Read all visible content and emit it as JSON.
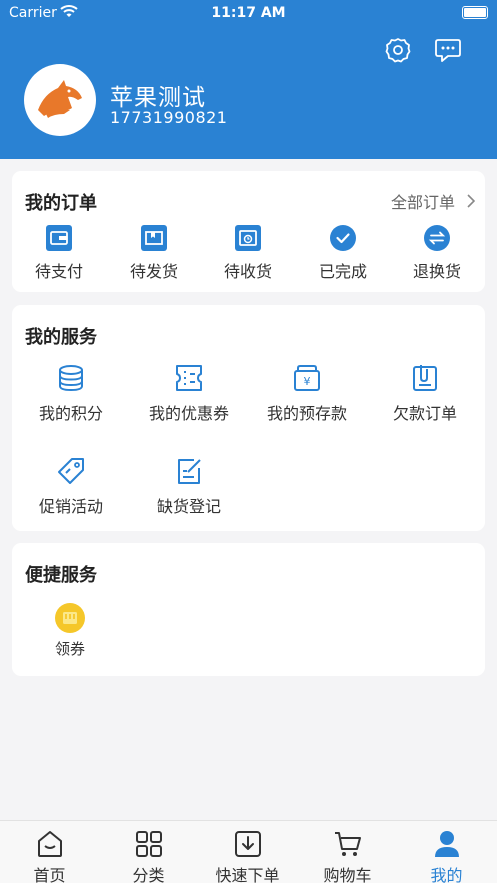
{
  "status_bar": {
    "carrier": "Carrier",
    "time": "11:17 AM"
  },
  "user": {
    "name": "苹果测试",
    "phone": "17731990821"
  },
  "orders": {
    "title": "我的订单",
    "all_label": "全部订单",
    "items": [
      {
        "label": "待支付",
        "icon": "wallet-icon"
      },
      {
        "label": "待发货",
        "icon": "box-icon"
      },
      {
        "label": "待收货",
        "icon": "clock-icon"
      },
      {
        "label": "已完成",
        "icon": "check-circle-icon"
      },
      {
        "label": "退换货",
        "icon": "exchange-icon"
      }
    ]
  },
  "services": {
    "title": "我的服务",
    "items": [
      {
        "label": "我的积分",
        "icon": "coins-icon"
      },
      {
        "label": "我的优惠券",
        "icon": "ticket-icon"
      },
      {
        "label": "我的预存款",
        "icon": "deposit-icon"
      },
      {
        "label": "欠款订单",
        "icon": "clipboard-icon"
      },
      {
        "label": "促销活动",
        "icon": "tag-icon"
      },
      {
        "label": "缺货登记",
        "icon": "edit-icon"
      }
    ]
  },
  "quick": {
    "title": "便捷服务",
    "items": [
      {
        "label": "领券",
        "icon": "coupon-icon"
      }
    ]
  },
  "tabbar": {
    "items": [
      {
        "label": "首页",
        "icon": "home-icon"
      },
      {
        "label": "分类",
        "icon": "grid-icon"
      },
      {
        "label": "快速下单",
        "icon": "download-icon"
      },
      {
        "label": "购物车",
        "icon": "cart-icon"
      },
      {
        "label": "我的",
        "icon": "person-icon",
        "active": true
      }
    ]
  },
  "colors": {
    "primary": "#2a82d3",
    "header_bg": "#2a82d3",
    "page_bg": "#f4f4f6",
    "coupon": "#f5c72a",
    "logo": "#e8782a"
  }
}
